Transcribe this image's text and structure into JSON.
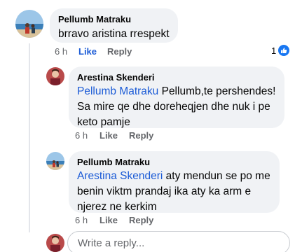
{
  "comments": [
    {
      "author": "Pellumb Matraku",
      "text": "brravo aristina rrespekt",
      "time": "6 h",
      "like_label": "Like",
      "reply_label": "Reply",
      "reaction_count": "1"
    },
    {
      "author": "Arestina Skenderi",
      "mention": "Pellumb Matraku",
      "line1_rest": " Pellumb,te pershendes!",
      "line2": "Sa mire qe dhe doreheqjen dhe nuk i pe",
      "line3": "keto pamje",
      "time": "6 h",
      "like_label": "Like",
      "reply_label": "Reply"
    },
    {
      "author": "Pellumb Matraku",
      "mention": "Arestina Skenderi",
      "line1_rest": " aty mendun se po me",
      "line2": "benin viktm prandaj ika aty ka arm e",
      "line3": "njerez ne kerkim",
      "time": "6 h",
      "like_label": "Like",
      "reply_label": "Reply"
    }
  ],
  "reply_box": {
    "placeholder": "Write a reply..."
  },
  "colors": {
    "bubble": "#f0f2f5",
    "link": "#1b5bd6",
    "meta": "#65676b",
    "like_blue": "#1877f2"
  }
}
